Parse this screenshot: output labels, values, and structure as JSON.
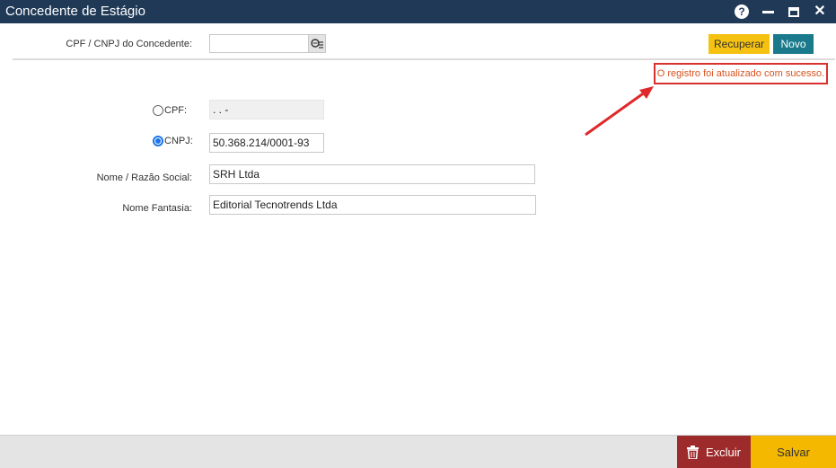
{
  "window": {
    "title": "Concedente de Estágio",
    "icons": [
      "help-icon",
      "minimize-icon",
      "maximize-icon",
      "close-icon"
    ],
    "help_glyph": "?"
  },
  "search": {
    "label": "CPF / CNPJ do Concedente:",
    "value": "",
    "lookup_icon": "search-list-icon"
  },
  "actions": {
    "recuperar_label": "Recuperar",
    "novo_label": "Novo"
  },
  "status_message": "O registro foi atualizado com sucesso.",
  "form": {
    "cpf": {
      "label": "CPF:",
      "value": "  .   .   -",
      "selected": false
    },
    "cnpj": {
      "label": "CNPJ:",
      "value": "50.368.214/0001-93",
      "selected": true
    },
    "nome_razao": {
      "label": "Nome / Razão Social:",
      "value": "SRH Ltda"
    },
    "nome_fantasia": {
      "label": "Nome Fantasia:",
      "value": "Editorial Tecnotrends Ltda"
    }
  },
  "footer": {
    "excluir_label": "Excluir",
    "salvar_label": "Salvar",
    "excluir_icon": "trash-icon"
  },
  "colors": {
    "titlebar": "#1f3956",
    "recuperar": "#f5c211",
    "novo": "#1a7a8c",
    "excluir": "#9e2b2b",
    "salvar": "#f5b800",
    "status_border": "#d8312f",
    "annotation_arrow": "#e0282a"
  }
}
